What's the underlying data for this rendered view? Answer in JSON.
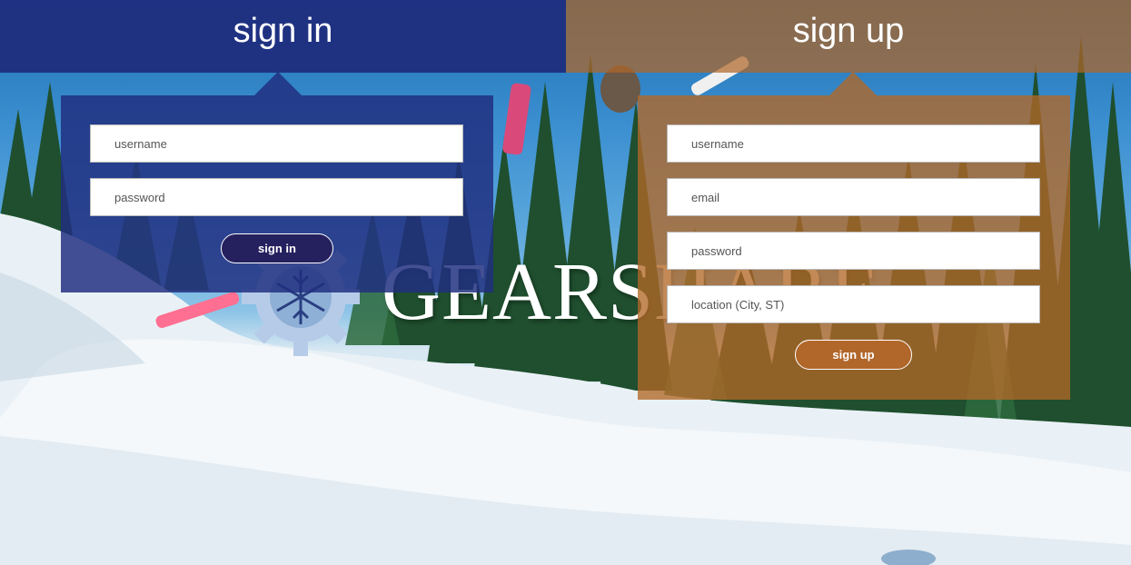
{
  "tabs": {
    "signin_label": "sign in",
    "signup_label": "sign up"
  },
  "signin_form": {
    "username_placeholder": "username",
    "password_placeholder": "password",
    "submit_label": "sign in"
  },
  "signup_form": {
    "username_placeholder": "username",
    "email_placeholder": "email",
    "password_placeholder": "password",
    "location_placeholder": "location (City, ST)",
    "submit_label": "sign up"
  },
  "logo": {
    "text": "GEARSHARE",
    "icon": "snowflake-gear-icon"
  },
  "colors": {
    "signin_blue": "#1f3080",
    "signup_orange": "#b0662a",
    "gear_blue": "#b6cbe8"
  }
}
